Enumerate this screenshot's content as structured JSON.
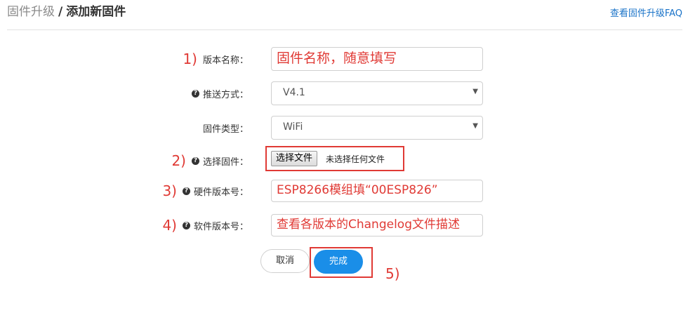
{
  "header": {
    "breadcrumb_parent": "固件升级",
    "breadcrumb_separator": "/",
    "breadcrumb_current": "添加新固件",
    "faq_link": "查看固件升级FAQ"
  },
  "form": {
    "version_name": {
      "step": "1)",
      "label": "版本名称：",
      "value": "固件名称，随意填写"
    },
    "push_method": {
      "label": "推送方式：",
      "selected": "V4.1"
    },
    "firmware_type": {
      "label": "固件类型：",
      "selected": "WiFi"
    },
    "choose_firmware": {
      "step": "2)",
      "label": "选择固件：",
      "button": "选择文件",
      "status": "未选择任何文件"
    },
    "hardware_version": {
      "step": "3)",
      "label": "硬件版本号：",
      "value": "ESP8266模组填“00ESP826”"
    },
    "software_version": {
      "step": "4)",
      "label": "软件版本号：",
      "value": "查看各版本的Changelog文件描述"
    }
  },
  "actions": {
    "cancel": "取消",
    "done": "完成",
    "done_step": "5)"
  },
  "colors": {
    "annotation_red": "#e03a35",
    "primary_blue": "#1a8ee8",
    "link_blue": "#1a73c8"
  },
  "icons": {
    "help": "question-circle-icon",
    "dropdown": "caret-down-icon"
  }
}
